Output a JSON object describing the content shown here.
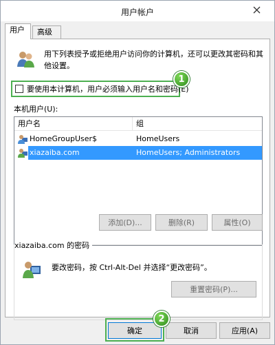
{
  "window": {
    "title": "用户帐户"
  },
  "tabs": [
    {
      "label": "用户"
    },
    {
      "label": "高级"
    }
  ],
  "intro_text": "用下列表授予或拒绝用户访问你的计算机，还可以更改其密码和其他设置。",
  "require_login": {
    "label": "要使用本计算机，用户必须输入用户名和密码(E)",
    "checked": false
  },
  "badges": {
    "one": "1",
    "two": "2"
  },
  "users_label": "本机用户(U):",
  "table": {
    "headers": [
      "用户名",
      "组"
    ],
    "rows": [
      {
        "name": "HomeGroupUser$",
        "group": "HomeUsers"
      },
      {
        "name": "xiazaiba.com",
        "group": "HomeUsers; Administrators"
      }
    ]
  },
  "list_buttons": {
    "add": "添加(D)...",
    "remove": "删除(R)",
    "properties": "属性(O)"
  },
  "password_group": {
    "title": "xiazaiba.com 的密码",
    "text": "要改密码，按 Ctrl-Alt-Del 并选择“更改密码”。",
    "reset_button": "重置密码(P)..."
  },
  "dialog_buttons": {
    "ok": "确定",
    "cancel": "取消",
    "apply": "应用(A)"
  },
  "icons": {
    "close": "close-icon",
    "users": "users-icon",
    "user": "user-icon",
    "password_user": "password-user-icon"
  },
  "colors": {
    "selection": "#3399ff",
    "highlight": "#4caf50"
  }
}
